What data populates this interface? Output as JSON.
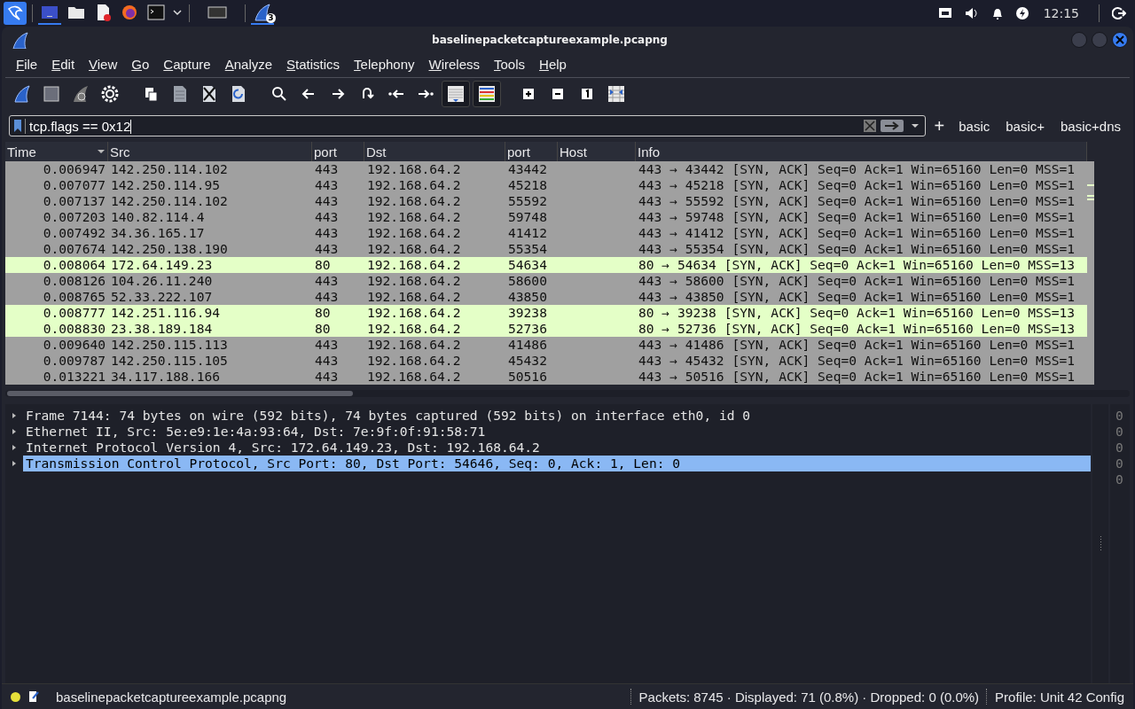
{
  "taskbar": {
    "badge": "3",
    "clock": "12:15"
  },
  "window": {
    "title": "baselinepacketcaptureexample.pcapng"
  },
  "menu": [
    "File",
    "Edit",
    "View",
    "Go",
    "Capture",
    "Analyze",
    "Statistics",
    "Telephony",
    "Wireless",
    "Tools",
    "Help"
  ],
  "filter": {
    "value": "tcp.flags == 0x12",
    "buttons": [
      "basic",
      "basic+",
      "basic+dns"
    ],
    "add": "+"
  },
  "packet_list": {
    "columns": [
      {
        "label": "Time",
        "sorted": true
      },
      {
        "label": "Src",
        "sorted": false
      },
      {
        "label": "port",
        "sorted": false
      },
      {
        "label": "Dst",
        "sorted": false
      },
      {
        "label": "port",
        "sorted": false
      },
      {
        "label": "Host",
        "sorted": false
      },
      {
        "label": "Info",
        "sorted": false
      }
    ],
    "rows": [
      {
        "cells": [
          "0.006947",
          "142.250.114.102",
          "443",
          "192.168.64.2",
          "43442",
          "",
          "443 → 43442 [SYN, ACK] Seq=0 Ack=1 Win=65160 Len=0 MSS=1"
        ],
        "color": "#a0a0a0"
      },
      {
        "cells": [
          "0.007077",
          "142.250.114.95",
          "443",
          "192.168.64.2",
          "45218",
          "",
          "443 → 45218 [SYN, ACK] Seq=0 Ack=1 Win=65160 Len=0 MSS=1"
        ],
        "color": "#a0a0a0"
      },
      {
        "cells": [
          "0.007137",
          "142.250.114.102",
          "443",
          "192.168.64.2",
          "55592",
          "",
          "443 → 55592 [SYN, ACK] Seq=0 Ack=1 Win=65160 Len=0 MSS=1"
        ],
        "color": "#a0a0a0"
      },
      {
        "cells": [
          "0.007203",
          "140.82.114.4",
          "443",
          "192.168.64.2",
          "59748",
          "",
          "443 → 59748 [SYN, ACK] Seq=0 Ack=1 Win=65160 Len=0 MSS=1"
        ],
        "color": "#a0a0a0"
      },
      {
        "cells": [
          "0.007492",
          "34.36.165.17",
          "443",
          "192.168.64.2",
          "41412",
          "",
          "443 → 41412 [SYN, ACK] Seq=0 Ack=1 Win=65160 Len=0 MSS=1"
        ],
        "color": "#a0a0a0"
      },
      {
        "cells": [
          "0.007674",
          "142.250.138.190",
          "443",
          "192.168.64.2",
          "55354",
          "",
          "443 → 55354 [SYN, ACK] Seq=0 Ack=1 Win=65160 Len=0 MSS=1"
        ],
        "color": "#a0a0a0"
      },
      {
        "cells": [
          "0.008064",
          "172.64.149.23",
          "80",
          "192.168.64.2",
          "54634",
          "",
          "80 → 54634 [SYN, ACK] Seq=0 Ack=1 Win=65160 Len=0 MSS=13"
        ],
        "color": "#e4ffc7"
      },
      {
        "cells": [
          "0.008126",
          "104.26.11.240",
          "443",
          "192.168.64.2",
          "58600",
          "",
          "443 → 58600 [SYN, ACK] Seq=0 Ack=1 Win=65160 Len=0 MSS=1"
        ],
        "color": "#a0a0a0"
      },
      {
        "cells": [
          "0.008765",
          "52.33.222.107",
          "443",
          "192.168.64.2",
          "43850",
          "",
          "443 → 43850 [SYN, ACK] Seq=0 Ack=1 Win=65160 Len=0 MSS=1"
        ],
        "color": "#a0a0a0"
      },
      {
        "cells": [
          "0.008777",
          "142.251.116.94",
          "80",
          "192.168.64.2",
          "39238",
          "",
          "80 → 39238 [SYN, ACK] Seq=0 Ack=1 Win=65160 Len=0 MSS=13"
        ],
        "color": "#e4ffc7"
      },
      {
        "cells": [
          "0.008830",
          "23.38.189.184",
          "80",
          "192.168.64.2",
          "52736",
          "",
          "80 → 52736 [SYN, ACK] Seq=0 Ack=1 Win=65160 Len=0 MSS=13"
        ],
        "color": "#e4ffc7"
      },
      {
        "cells": [
          "0.009640",
          "142.250.115.113",
          "443",
          "192.168.64.2",
          "41486",
          "",
          "443 → 41486 [SYN, ACK] Seq=0 Ack=1 Win=65160 Len=0 MSS=1"
        ],
        "color": "#a0a0a0"
      },
      {
        "cells": [
          "0.009787",
          "142.250.115.105",
          "443",
          "192.168.64.2",
          "45432",
          "",
          "443 → 45432 [SYN, ACK] Seq=0 Ack=1 Win=65160 Len=0 MSS=1"
        ],
        "color": "#a0a0a0"
      },
      {
        "cells": [
          "0.013221",
          "34.117.188.166",
          "443",
          "192.168.64.2",
          "50516",
          "",
          "443 → 50516 [SYN, ACK] Seq=0 Ack=1 Win=65160 Len=0 MSS=1"
        ],
        "color": "#a0a0a0"
      }
    ]
  },
  "details": [
    {
      "text": "Frame 7144: 74 bytes on wire (592 bits), 74 bytes captured (592 bits) on interface eth0, id 0",
      "expanded": false,
      "selected": false
    },
    {
      "text": "Ethernet II, Src: 5e:e9:1e:4a:93:64, Dst: 7e:9f:0f:91:58:71",
      "expanded": false,
      "selected": false
    },
    {
      "text": "Internet Protocol Version 4, Src: 172.64.149.23, Dst: 192.168.64.2",
      "expanded": false,
      "selected": false
    },
    {
      "text": "Transmission Control Protocol, Src Port: 80, Dst Port: 54646, Seq: 0, Ack: 1, Len: 0",
      "expanded": false,
      "selected": true
    }
  ],
  "bytes": [
    "0",
    "0",
    "0",
    "0",
    "0"
  ],
  "status_bar": {
    "file": "baselinepacketcaptureexample.pcapng",
    "packets": "Packets: 8745 · Displayed: 71 (0.8%) · Dropped: 0 (0.0%)",
    "profile": "Profile: Unit 42 Config"
  }
}
